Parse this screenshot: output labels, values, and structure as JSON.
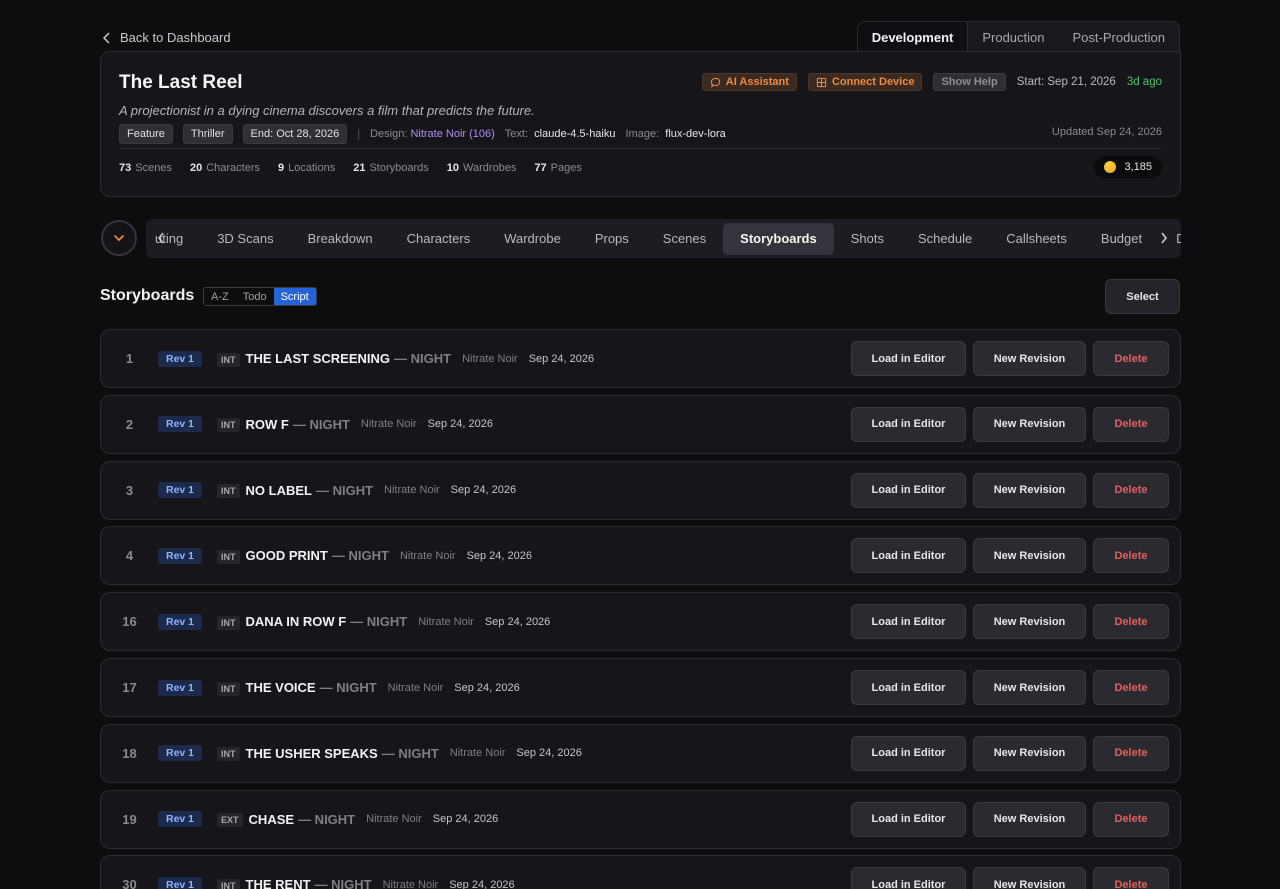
{
  "nav": {
    "back_label": "Back to Dashboard"
  },
  "phases": [
    "Development",
    "Production",
    "Post-Production"
  ],
  "project": {
    "title": "The Last Reel",
    "logline": "A projectionist in a dying cinema discovers a film that predicts the future.",
    "ai_assistant": "AI Assistant",
    "connect_device": "Connect Device",
    "show_help": "Show Help",
    "start": "Start: Sep 21, 2026",
    "ago": "3d ago",
    "tags": [
      "Feature",
      "Thriller",
      "End: Oct 28, 2026"
    ],
    "design_label": "Design:",
    "design_value": "Nitrate Noir (106)",
    "text_label": "Text:",
    "text_value": "claude-4.5-haiku",
    "image_label": "Image:",
    "image_value": "flux-dev-lora",
    "updated": "Updated Sep 24, 2026",
    "stats": [
      {
        "count": "73",
        "label": "Scenes"
      },
      {
        "count": "20",
        "label": "Characters"
      },
      {
        "count": "9",
        "label": "Locations"
      },
      {
        "count": "21",
        "label": "Storyboards"
      },
      {
        "count": "10",
        "label": "Wardrobes"
      },
      {
        "count": "77",
        "label": "Pages"
      }
    ],
    "credits": "3,185"
  },
  "departments": [
    "uting",
    "3D Scans",
    "Breakdown",
    "Characters",
    "Wardrobe",
    "Props",
    "Scenes",
    "Storyboards",
    "Shots",
    "Schedule",
    "Callsheets",
    "Budget",
    "Deals"
  ],
  "active_department": "Storyboards",
  "section": {
    "title": "Storyboards",
    "sort_options": [
      "A-Z",
      "Todo",
      "Script"
    ],
    "active_sort": "Script",
    "select_label": "Select"
  },
  "row_actions": {
    "load": "Load in Editor",
    "new": "New Revision",
    "delete": "Delete"
  },
  "storyboards": [
    {
      "num": "1",
      "rev": "Rev 1",
      "ie": "INT",
      "slug": "THE LAST SCREENING",
      "tod": "— NIGHT",
      "style": "Nitrate Noir",
      "date": "Sep 24, 2026"
    },
    {
      "num": "2",
      "rev": "Rev 1",
      "ie": "INT",
      "slug": "ROW F",
      "tod": "— NIGHT",
      "style": "Nitrate Noir",
      "date": "Sep 24, 2026"
    },
    {
      "num": "3",
      "rev": "Rev 1",
      "ie": "INT",
      "slug": "NO LABEL",
      "tod": "— NIGHT",
      "style": "Nitrate Noir",
      "date": "Sep 24, 2026"
    },
    {
      "num": "4",
      "rev": "Rev 1",
      "ie": "INT",
      "slug": "GOOD PRINT",
      "tod": "— NIGHT",
      "style": "Nitrate Noir",
      "date": "Sep 24, 2026"
    },
    {
      "num": "16",
      "rev": "Rev 1",
      "ie": "INT",
      "slug": "DANA IN ROW F",
      "tod": "— NIGHT",
      "style": "Nitrate Noir",
      "date": "Sep 24, 2026"
    },
    {
      "num": "17",
      "rev": "Rev 1",
      "ie": "INT",
      "slug": "THE VOICE",
      "tod": "— NIGHT",
      "style": "Nitrate Noir",
      "date": "Sep 24, 2026"
    },
    {
      "num": "18",
      "rev": "Rev 1",
      "ie": "INT",
      "slug": "THE USHER SPEAKS",
      "tod": "— NIGHT",
      "style": "Nitrate Noir",
      "date": "Sep 24, 2026"
    },
    {
      "num": "19",
      "rev": "Rev 1",
      "ie": "EXT",
      "slug": "CHASE",
      "tod": "— NIGHT",
      "style": "Nitrate Noir",
      "date": "Sep 24, 2026"
    },
    {
      "num": "30",
      "rev": "Rev 1",
      "ie": "INT",
      "slug": "THE RENT",
      "tod": "— NIGHT",
      "style": "Nitrate Noir",
      "date": "Sep 24, 2026"
    }
  ]
}
